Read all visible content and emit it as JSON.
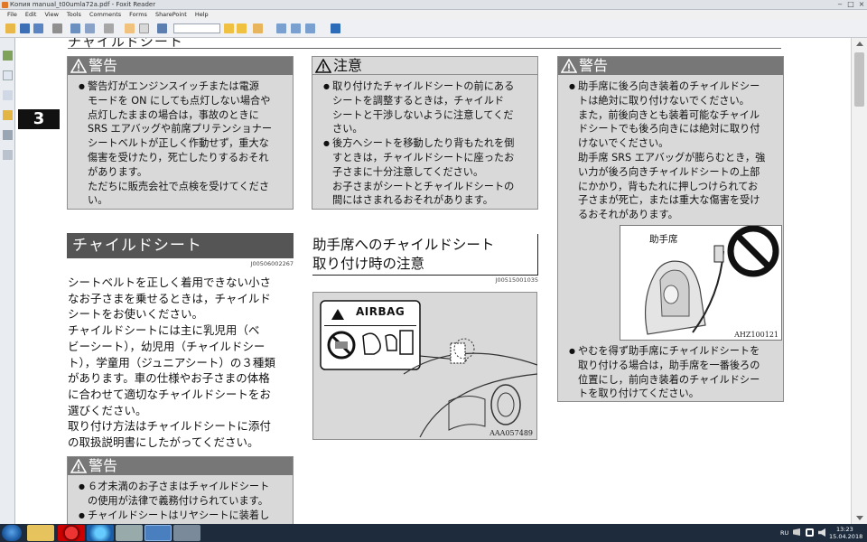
{
  "window": {
    "title": "Копия manual_t00umla72a.pdf - Foxit Reader"
  },
  "menu": [
    "File",
    "Edit",
    "View",
    "Tools",
    "Comments",
    "Forms",
    "SharePoint",
    "Help"
  ],
  "page": {
    "header_text": "チャイルドシート",
    "chapter_number": "3",
    "col1": {
      "warning1": {
        "heading": "警告",
        "items": [
          "警告灯がエンジンスイッチまたは電源モードを ON にしても点灯しない場合や点灯したままの場合は，事故のときに SRS エアバッグや前席プリテンショナーシートベルトが正しく作動せず，重大な傷害を受けたり，死亡したりするおそれがあります。",
          "ただちに販売会社で点検を受けてください。"
        ],
        "lines": [
          "警告灯がエンジンスイッチまたは電源",
          "モードを ON にしても点灯しない場合や",
          "点灯したままの場合は，事故のときに",
          "SRS エアバッグや前席プリテンショナー",
          "シートベルトが正しく作動せず，重大な",
          "傷害を受けたり，死亡したりするおそれ",
          "があります。",
          "ただちに販売会社で点検を受けてくださ",
          "い。"
        ]
      },
      "section": {
        "title": "チャイルドシート",
        "code": "J00506002267",
        "lines": [
          "シートベルトを正しく着用できない小さ",
          "なお子さまを乗せるときは，チャイルド",
          "シートをお使いください。",
          "チャイルドシートには主に乳児用（ベ",
          "ビーシート），幼児用（チャイルドシー",
          "ト），学童用（ジュニアシート）の３種類",
          "があります。車の仕様やお子さまの体格",
          "に合わせて適切なチャイルドシートをお",
          "選びください。",
          "取り付け方法はチャイルドシートに添付",
          "の取扱説明書にしたがってください。"
        ]
      },
      "warning2": {
        "heading": "警告",
        "lines": [
          "６才未満のお子さまはチャイルドシート",
          "の使用が法律で義務付けられています。",
          "チャイルドシートはリヤシートに装着し"
        ]
      }
    },
    "col2": {
      "caution": {
        "heading": "注意",
        "lines": [
          "取り付けたチャイルドシートの前にある",
          "シートを調整するときは，チャイルド",
          "シートと干渉しないように注意してくだ",
          "さい。",
          "後方へシートを移動したり背もたれを倒",
          "すときは，チャイルドシートに座ったお",
          "子さまに十分注意してください。",
          "お子さまがシートとチャイルドシートの",
          "間にはさまれるおそれがあります。"
        ]
      },
      "section": {
        "title_line1": "助手席へのチャイルドシート",
        "title_line2": "取り付け時の注意",
        "code": "J00515001035"
      },
      "figure": {
        "label": "AIRBAG",
        "code": "AAA057489"
      }
    },
    "col3": {
      "warning": {
        "heading": "警告",
        "lines": [
          "助手席に後ろ向き装着のチャイルドシー",
          "トは絶対に取り付けないでください。",
          "また，前後向きとも装着可能なチャイル",
          "ドシートでも後ろ向きには絶対に取り付",
          "けないでください。",
          "助手席 SRS エアバッグが膨らむとき，強",
          "い力が後ろ向きチャイルドシートの上部",
          "にかかり，背もたれに押しつけられてお",
          "子さまが死亡，または重大な傷害を受け",
          "るおそれがあります。"
        ],
        "figure_label": "助手席",
        "figure_code": "AHZ100121",
        "lines2": [
          "やむを得ず助手席にチャイルドシートを",
          "取り付ける場合は，助手席を一番後ろの",
          "位置にし，前向き装着のチャイルドシー",
          "トを取り付けてください。"
        ]
      }
    }
  },
  "taskbar": {
    "lang": "RU",
    "time": "13:23",
    "date": "15.04.2018"
  },
  "colors": {
    "warning_header": "#777777",
    "box_bg": "#d9d9d9",
    "section_title": "#555555"
  }
}
